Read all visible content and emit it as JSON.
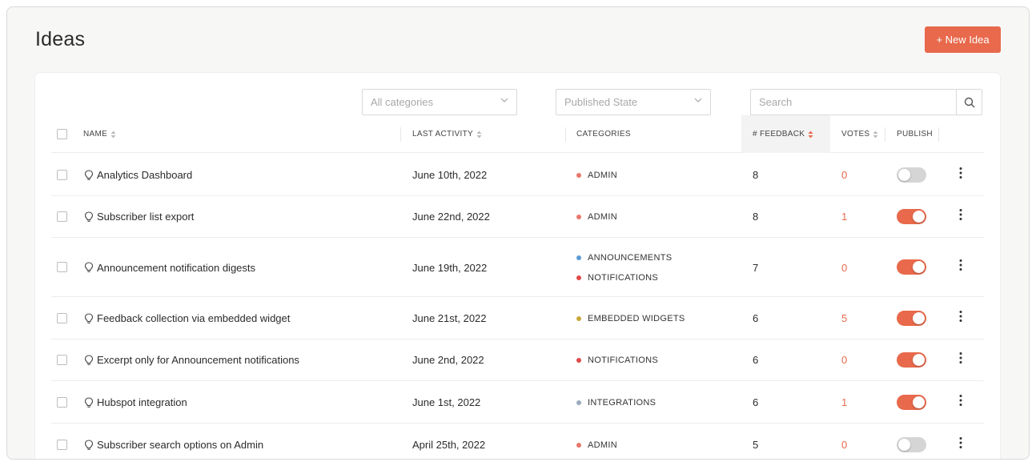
{
  "page": {
    "title": "Ideas",
    "new_button_label": "+ New Idea"
  },
  "filters": {
    "categories_placeholder": "All categories",
    "published_placeholder": "Published State",
    "search_placeholder": "Search"
  },
  "columns": {
    "name": "NAME",
    "last_activity": "LAST ACTIVITY",
    "categories": "CATEGORIES",
    "feedback": "# FEEDBACK",
    "votes": "VOTES",
    "publish": "PUBLISH"
  },
  "colors": {
    "accent": "#e8694b",
    "admin": "#e8776a",
    "announcements": "#5b9bd5",
    "notifications": "#e24a4a",
    "embedded_widgets": "#c9a83a",
    "integrations": "#9aabbd"
  },
  "rows": [
    {
      "name": "Analytics Dashboard",
      "date": "June 10th, 2022",
      "categories": [
        {
          "label": "ADMIN",
          "color": "#e8776a"
        }
      ],
      "feedback": "8",
      "votes": "0",
      "published": false
    },
    {
      "name": "Subscriber list export",
      "date": "June 22nd, 2022",
      "categories": [
        {
          "label": "ADMIN",
          "color": "#e8776a"
        }
      ],
      "feedback": "8",
      "votes": "1",
      "published": true
    },
    {
      "name": "Announcement notification digests",
      "date": "June 19th, 2022",
      "categories": [
        {
          "label": "ANNOUNCEMENTS",
          "color": "#5b9bd5"
        },
        {
          "label": "NOTIFICATIONS",
          "color": "#e24a4a"
        }
      ],
      "feedback": "7",
      "votes": "0",
      "published": true
    },
    {
      "name": "Feedback collection via embedded widget",
      "date": "June 21st, 2022",
      "categories": [
        {
          "label": "EMBEDDED WIDGETS",
          "color": "#c9a83a"
        }
      ],
      "feedback": "6",
      "votes": "5",
      "published": true
    },
    {
      "name": "Excerpt only for Announcement notifications",
      "date": "June 2nd, 2022",
      "categories": [
        {
          "label": "NOTIFICATIONS",
          "color": "#e24a4a"
        }
      ],
      "feedback": "6",
      "votes": "0",
      "published": true
    },
    {
      "name": "Hubspot integration",
      "date": "June 1st, 2022",
      "categories": [
        {
          "label": "INTEGRATIONS",
          "color": "#9aabbd"
        }
      ],
      "feedback": "6",
      "votes": "1",
      "published": true
    },
    {
      "name": "Subscriber search options on Admin",
      "date": "April 25th, 2022",
      "categories": [
        {
          "label": "ADMIN",
          "color": "#e8776a"
        }
      ],
      "feedback": "5",
      "votes": "0",
      "published": false
    }
  ]
}
